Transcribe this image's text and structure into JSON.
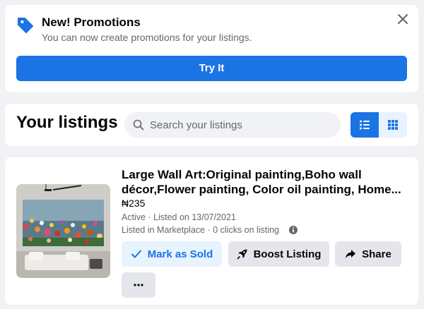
{
  "promo": {
    "title": "New! Promotions",
    "subtitle": "You can now create promotions for your listings.",
    "button_label": "Try It",
    "icon": "tag-icon"
  },
  "header": {
    "title": "Your listings",
    "search_placeholder": "Search your listings",
    "view_modes": [
      "list",
      "grid"
    ],
    "active_view": "list"
  },
  "listing": {
    "title": "Large Wall Art:Original painting,Boho wall décor,Flower painting, Color oil painting, Home...",
    "price": "₦235",
    "status": "Active · Listed on 13/07/2021",
    "marketplace_info": "Listed in Marketplace · 0 clicks on listing",
    "actions": {
      "mark_sold": "Mark as Sold",
      "boost": "Boost Listing",
      "share": "Share"
    }
  },
  "colors": {
    "accent": "#1b74e4",
    "accent_light": "#e7f3ff",
    "page_bg": "#f0f2f5",
    "secondary_btn": "#e4e6eb",
    "secondary_text": "#65676b"
  }
}
